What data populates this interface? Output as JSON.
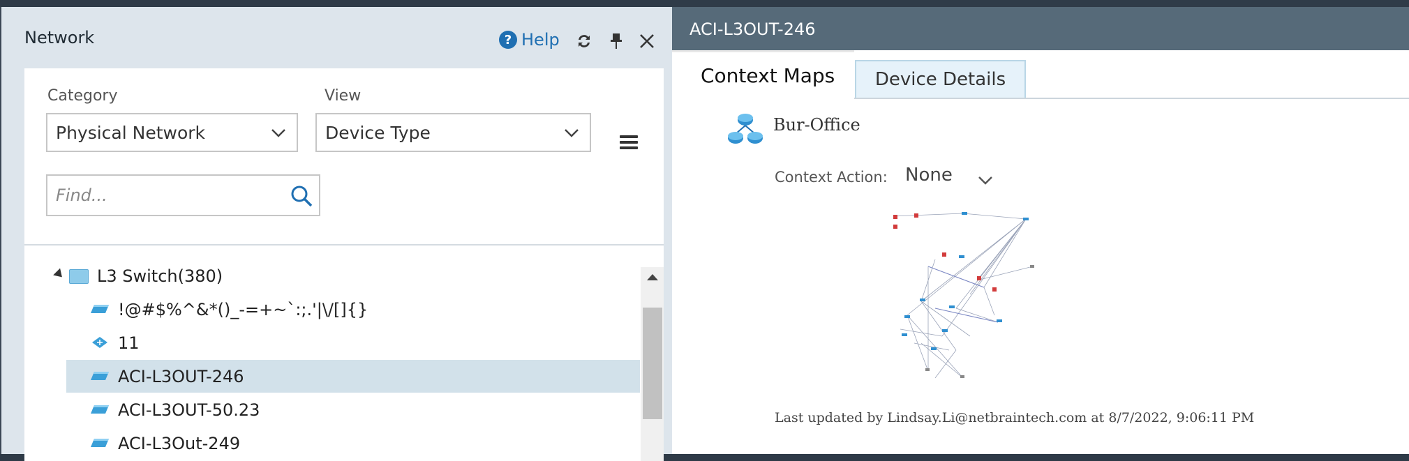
{
  "network_panel": {
    "title": "Network",
    "help_label": "Help",
    "category_label": "Category",
    "category_value": "Physical Network",
    "view_label": "View",
    "view_value": "Device Type",
    "find_placeholder": "Find...",
    "tree": {
      "group_label": "L3 Switch(380)",
      "items": [
        {
          "label": "!@#$%^&*()_-=+~`:;.'|\\/[]{}",
          "icon": "l3-switch-icon"
        },
        {
          "label": "11",
          "icon": "router-icon"
        },
        {
          "label": "ACI-L3OUT-246",
          "icon": "l3-switch-icon",
          "selected": true
        },
        {
          "label": "ACI-L3OUT-50.23",
          "icon": "l3-switch-icon"
        },
        {
          "label": "ACI-L3Out-249",
          "icon": "l3-switch-icon"
        }
      ]
    }
  },
  "detail_panel": {
    "title": "ACI-L3OUT-246",
    "tabs": [
      {
        "label": "Context Maps",
        "active": true
      },
      {
        "label": "Device Details",
        "active": false
      }
    ],
    "site_name": "Bur-Office",
    "context_action_label": "Context Action:",
    "context_action_value": "None",
    "last_updated": "Last updated by Lindsay.Li@netbraintech.com at 8/7/2022, 9:06:11 PM"
  },
  "colors": {
    "header_bg": "#566a79",
    "selected_row": "#d2e1ea",
    "link_blue": "#1f6fb2",
    "tab_inactive_bg": "#e6f2fa"
  }
}
